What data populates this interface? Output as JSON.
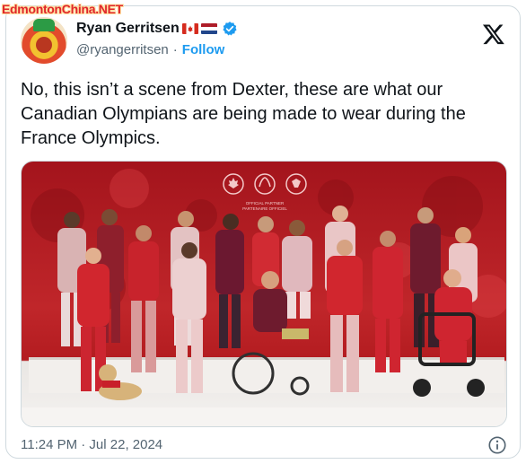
{
  "watermark": "EdmontonChina.NET",
  "author": {
    "name": "Ryan Gerritsen",
    "handle": "@ryangerritsen",
    "separator": "·",
    "follow_label": "Follow",
    "flags": [
      "canada-flag",
      "netherlands-flag"
    ],
    "verified": true
  },
  "tweet": {
    "text": "No, this isn’t a scene from Dexter, these are what our Canadian Olympians are being made to wear during the France Olympics."
  },
  "photo": {
    "sign_line1": "OFFICIAL PARTNER",
    "sign_line2": "PARTENAIRE OFFICIEL"
  },
  "timestamp": "11:24 PM · Jul 22, 2024",
  "colors": {
    "accent": "#1d9bf0",
    "text": "#0f1419",
    "muted": "#536471",
    "backdrop_red": "#b31c20"
  },
  "icons": {
    "logo": "x-logo-icon",
    "verified": "verified-badge-icon",
    "info": "info-icon"
  }
}
